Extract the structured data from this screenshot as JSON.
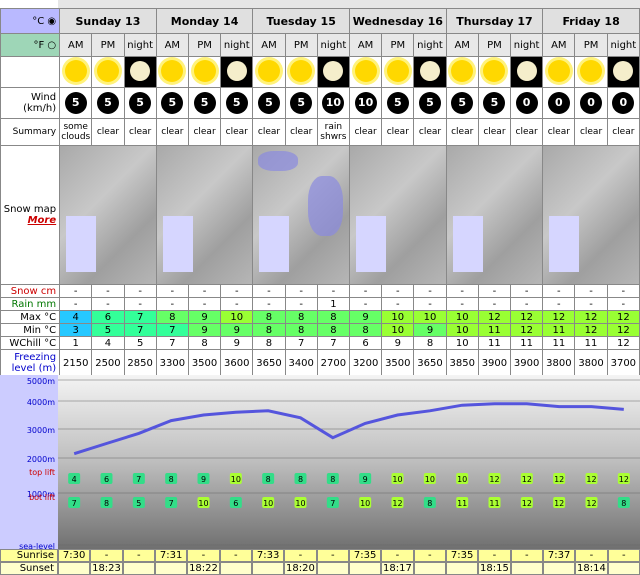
{
  "units": {
    "celsius": "°C",
    "fahrenheit": "°F"
  },
  "days": [
    {
      "name": "Sunday 13"
    },
    {
      "name": "Monday 14"
    },
    {
      "name": "Tuesday 15"
    },
    {
      "name": "Wednesday 16"
    },
    {
      "name": "Thursday 17"
    },
    {
      "name": "Friday 18"
    }
  ],
  "periods": [
    "AM",
    "PM",
    "night",
    "AM",
    "PM",
    "night",
    "AM",
    "PM",
    "night",
    "AM",
    "PM",
    "night",
    "AM",
    "PM",
    "night",
    "AM",
    "PM",
    "night"
  ],
  "icons": [
    "sun-cloud-icon",
    "sun-icon",
    "moon-icon",
    "sun-icon",
    "sun-icon",
    "moon-icon",
    "sun-icon",
    "sun-icon",
    "moon-rain-icon",
    "sun-icon",
    "sun-icon",
    "moon-icon",
    "sun-icon",
    "sun-icon",
    "moon-icon",
    "sun-icon",
    "sun-icon",
    "moon-icon"
  ],
  "labels": {
    "wind": "Wind (km/h)",
    "summary": "Summary",
    "snowmap": "Snow map",
    "more": "More",
    "snow": "Snow cm",
    "rain": "Rain mm",
    "max": "Max °C",
    "min": "Min °C",
    "wchill": "WChill °C",
    "freezing": "Freezing level (m)",
    "sunrise": "Sunrise",
    "sunset": "Sunset"
  },
  "wind": [
    "5",
    "5",
    "5",
    "5",
    "5",
    "5",
    "5",
    "5",
    "10",
    "10",
    "5",
    "5",
    "5",
    "5",
    "0",
    "0",
    "0",
    "0"
  ],
  "summary": [
    "some clouds",
    "clear",
    "clear",
    "clear",
    "clear",
    "clear",
    "clear",
    "clear",
    "rain shwrs",
    "clear",
    "clear",
    "clear",
    "clear",
    "clear",
    "clear",
    "clear",
    "clear",
    "clear"
  ],
  "snow": [
    "-",
    "-",
    "-",
    "-",
    "-",
    "-",
    "-",
    "-",
    "-",
    "-",
    "-",
    "-",
    "-",
    "-",
    "-",
    "-",
    "-",
    "-"
  ],
  "rain": [
    "-",
    "-",
    "-",
    "-",
    "-",
    "-",
    "-",
    "-",
    "1",
    "-",
    "-",
    "-",
    "-",
    "-",
    "-",
    "-",
    "-",
    "-"
  ],
  "max": [
    "4",
    "6",
    "7",
    "8",
    "9",
    "10",
    "8",
    "8",
    "8",
    "9",
    "10",
    "10",
    "10",
    "12",
    "12",
    "12",
    "12",
    "12"
  ],
  "min": [
    "3",
    "5",
    "7",
    "7",
    "9",
    "9",
    "8",
    "8",
    "8",
    "8",
    "10",
    "9",
    "10",
    "11",
    "12",
    "11",
    "12",
    "12"
  ],
  "wchill": [
    "1",
    "4",
    "5",
    "7",
    "8",
    "9",
    "8",
    "7",
    "7",
    "6",
    "9",
    "8",
    "10",
    "11",
    "11",
    "11",
    "11",
    "12"
  ],
  "freezing": [
    "2150",
    "2500",
    "2850",
    "3300",
    "3500",
    "3600",
    "3650",
    "3400",
    "2700",
    "3200",
    "3500",
    "3650",
    "3850",
    "3900",
    "3900",
    "3800",
    "3800",
    "3700"
  ],
  "chart": {
    "levels": [
      "5000m",
      "4000m",
      "3000m",
      "2000m",
      "1000m",
      "sea-level"
    ],
    "top_label": "top lift",
    "bot_label": "bot lift",
    "top_values": [
      "4",
      "6",
      "7",
      "8",
      "9",
      "10",
      "8",
      "8",
      "8",
      "9",
      "10",
      "10",
      "10",
      "12",
      "12",
      "12",
      "12",
      "12"
    ],
    "bot_values": [
      "7",
      "8",
      "5",
      "7",
      "10",
      "6",
      "10",
      "10",
      "7",
      "10",
      "12",
      "8",
      "11",
      "11",
      "12",
      "12",
      "12",
      "8"
    ]
  },
  "sunrise": [
    "7:30",
    "-",
    "-",
    "7:31",
    "-",
    "-",
    "7:33",
    "-",
    "-",
    "7:35",
    "-",
    "-",
    "7:35",
    "-",
    "-",
    "7:37",
    "-",
    "-"
  ],
  "sunset_row": [
    "",
    "18:23",
    "",
    "",
    "18:22",
    "",
    "",
    "18:20",
    "",
    "",
    "18:17",
    "",
    "",
    "18:15",
    "",
    "",
    "18:14",
    ""
  ]
}
